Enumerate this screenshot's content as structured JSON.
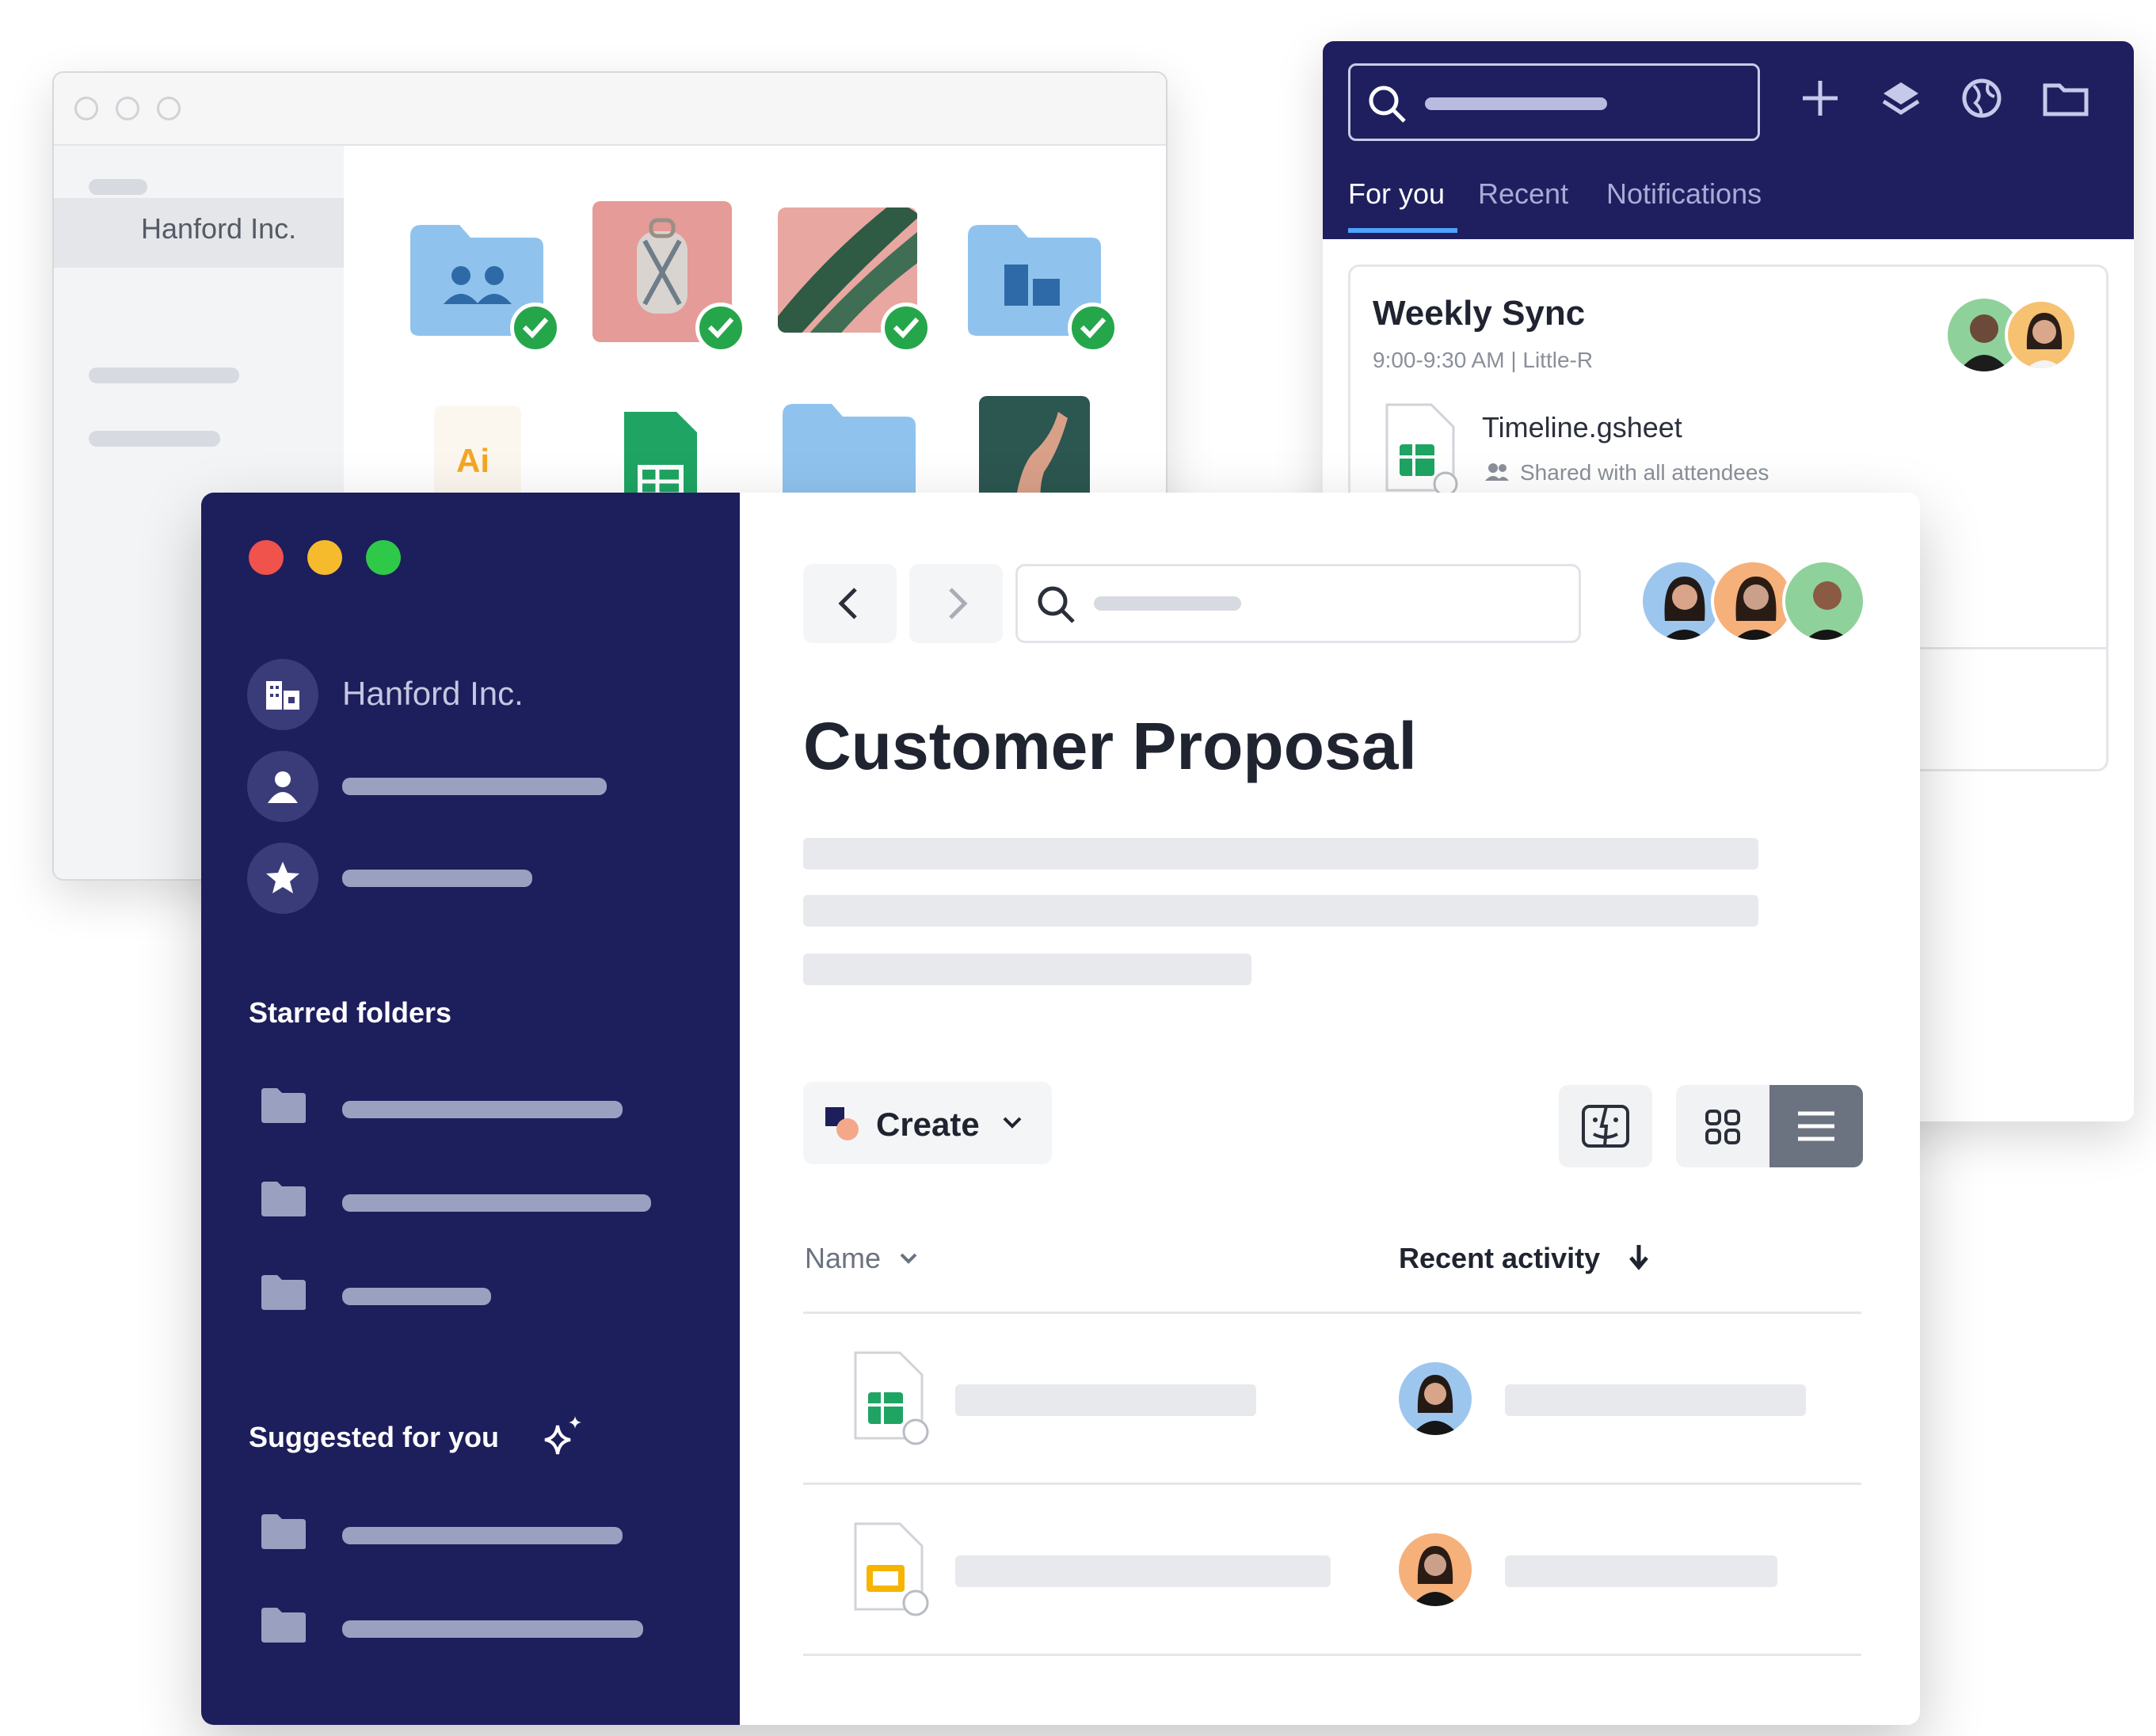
{
  "back_window": {
    "sidebar_item": "Hanford Inc.",
    "file_icon_text": "Ai"
  },
  "panel": {
    "tabs": [
      "For you",
      "Recent",
      "Notifications"
    ],
    "event": {
      "title": "Weekly Sync",
      "meta": "9:00-9:30 AM | Little-R"
    },
    "file": {
      "name": "Timeline.gsheet",
      "sharing": "Shared with all attendees"
    }
  },
  "front_window": {
    "workspace": "Hanford Inc.",
    "page_title": "Customer Proposal",
    "sidebar": {
      "starred_heading": "Starred folders",
      "suggested_heading": "Suggested for you"
    },
    "toolbar": {
      "create_label": "Create"
    },
    "table": {
      "col_name": "Name",
      "col_activity": "Recent activity"
    }
  },
  "colors": {
    "navy": "#1d1e5c",
    "green_check": "#26a64b",
    "folder_blue": "#8fc3ee",
    "accent_blue": "#4da3ff"
  },
  "icons": [
    "search-icon",
    "plus-icon",
    "layers-icon",
    "globe-icon",
    "folder-icon",
    "back-icon",
    "forward-icon",
    "sparkle-icon",
    "finder-icon",
    "grid-icon",
    "list-icon",
    "chevron-down-icon",
    "sort-down-icon",
    "spreadsheet-icon",
    "slides-icon"
  ]
}
